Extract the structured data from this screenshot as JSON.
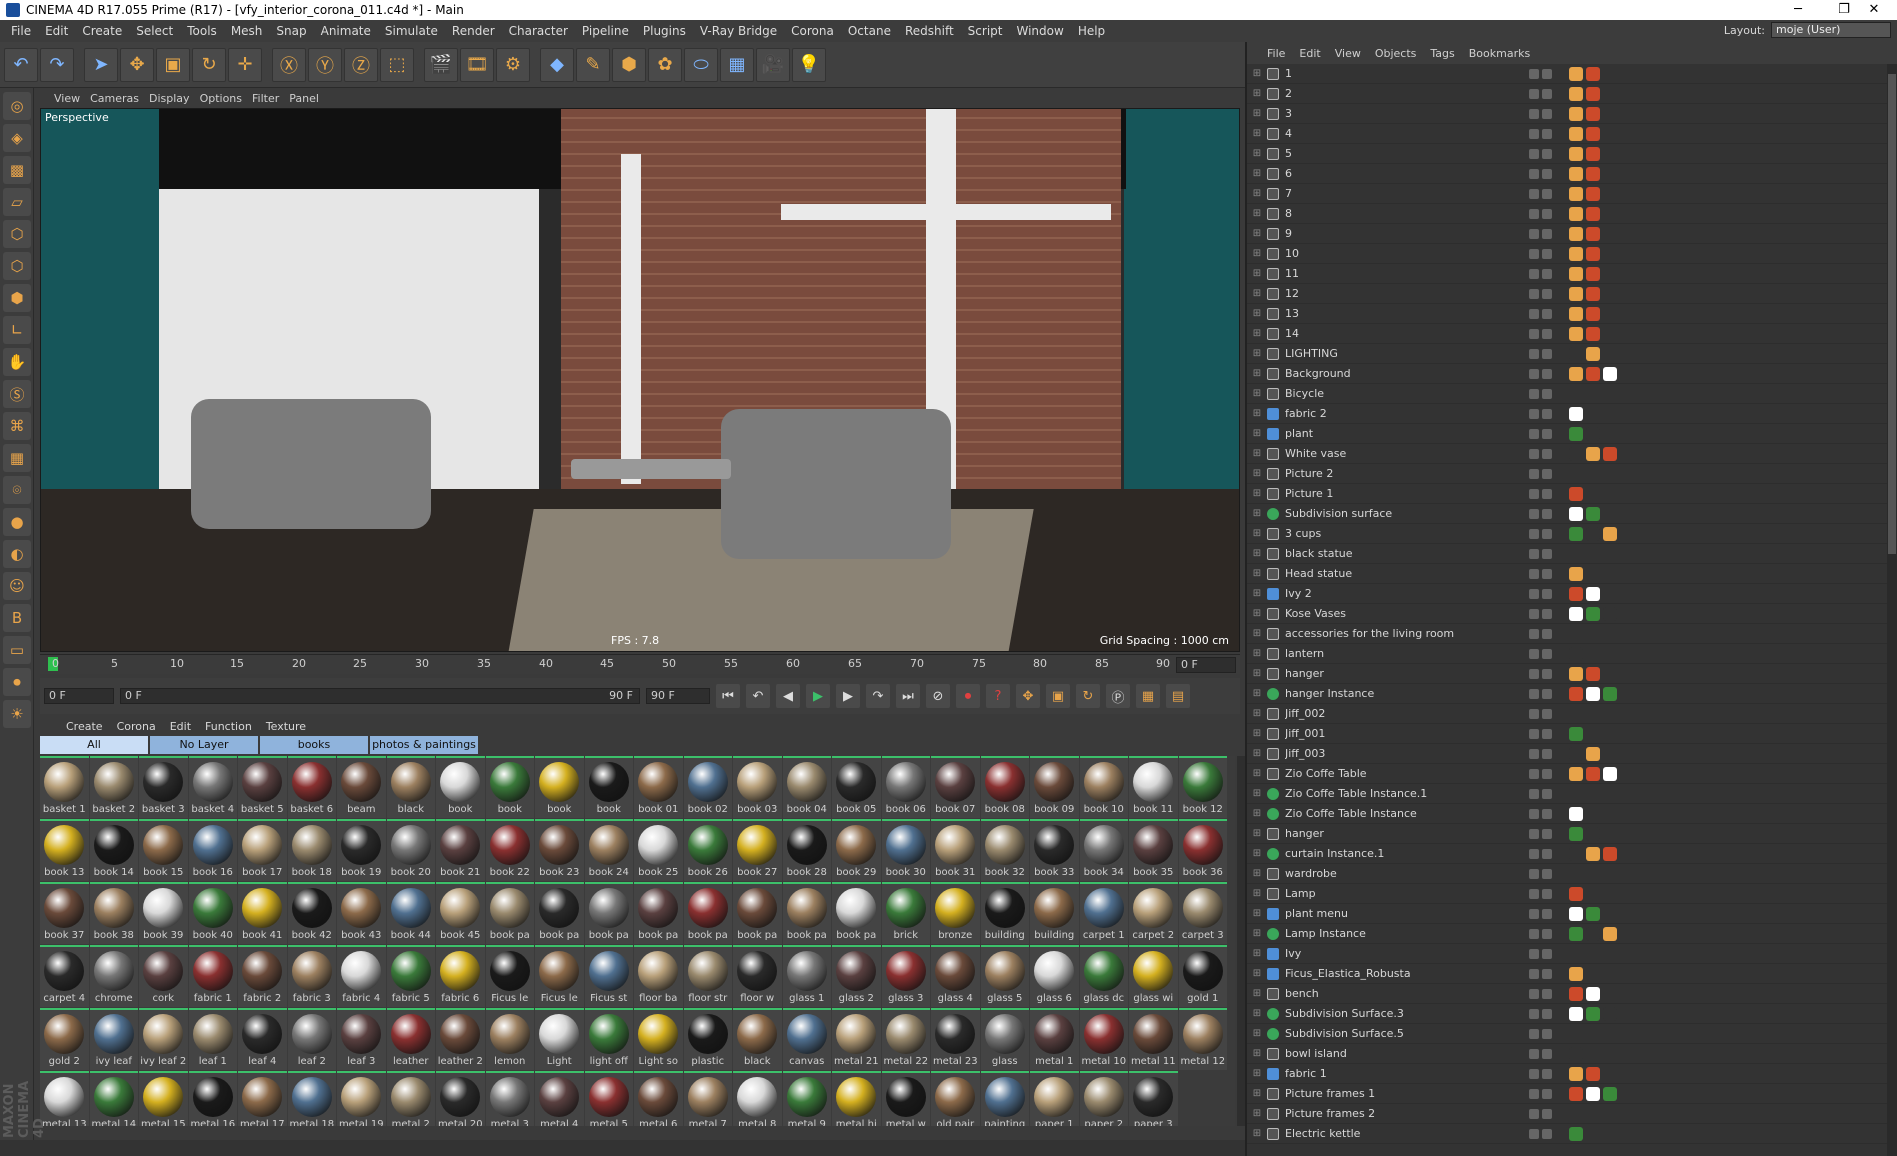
{
  "title": "CINEMA 4D R17.055 Prime (R17) - [vfy_interior_corona_011.c4d *] - Main",
  "menus": [
    "File",
    "Edit",
    "Create",
    "Select",
    "Tools",
    "Mesh",
    "Snap",
    "Animate",
    "Simulate",
    "Render",
    "Character",
    "Pipeline",
    "Plugins",
    "V-Ray Bridge",
    "Corona",
    "Octane",
    "Redshift",
    "Script",
    "Window",
    "Help"
  ],
  "layout_label": "Layout:",
  "layout_value": "moje (User)",
  "viewport": {
    "menu": [
      "View",
      "Cameras",
      "Display",
      "Options",
      "Filter",
      "Panel"
    ],
    "camera": "Perspective",
    "fps": "FPS : 7.8",
    "grid_spacing": "Grid Spacing : 1000 cm"
  },
  "timeline": {
    "ticks": [
      "0",
      "5",
      "10",
      "15",
      "20",
      "25",
      "30",
      "35",
      "40",
      "45",
      "50",
      "55",
      "60",
      "65",
      "70",
      "75",
      "80",
      "85",
      "90"
    ],
    "current_frame": "0 F"
  },
  "transport": {
    "start": "0 F",
    "range_start": "0 F",
    "range_end": "90 F",
    "end": "90 F"
  },
  "material_menu": [
    "Create",
    "Corona",
    "Edit",
    "Function",
    "Texture"
  ],
  "material_tabs": [
    "All",
    "No Layer",
    "books",
    "photos & paintings"
  ],
  "materials": [
    "basket 1",
    "basket 2",
    "basket 3",
    "basket 4",
    "basket 5",
    "basket 6",
    "beam",
    "black",
    "book",
    "book",
    "book",
    "book",
    "book 01",
    "book 02",
    "book 03",
    "book 04",
    "book 05",
    "book 06",
    "book 07",
    "book 08",
    "book 09",
    "book 10",
    "book 11",
    "book 12",
    "book 13",
    "book 14",
    "book 15",
    "book 16",
    "book 17",
    "book 18",
    "book 19",
    "book 20",
    "book 21",
    "book 22",
    "book 23",
    "book 24",
    "book 25",
    "book 26",
    "book 27",
    "book 28",
    "book 29",
    "book 30",
    "book 31",
    "book 32",
    "book 33",
    "book 34",
    "book 35",
    "book 36",
    "book 37",
    "book 38",
    "book 39",
    "book 40",
    "book 41",
    "book 42",
    "book 43",
    "book 44",
    "book 45",
    "book pa",
    "book pa",
    "book pa",
    "book pa",
    "book pa",
    "book pa",
    "book pa",
    "book pa",
    "brick",
    "bronze",
    "building",
    "building",
    "carpet 1",
    "carpet 2",
    "carpet 3",
    "carpet 4",
    "chrome",
    "cork",
    "fabric 1",
    "fabric 2",
    "fabric 3",
    "fabric 4",
    "fabric 5",
    "fabric 6",
    "Ficus le",
    "Ficus le",
    "Ficus st",
    "floor ba",
    "floor str",
    "floor w",
    "glass 1",
    "glass 2",
    "glass 3",
    "glass 4",
    "glass 5",
    "glass 6",
    "glass dc",
    "glass wi",
    "gold 1",
    "gold 2",
    "ivy leaf",
    "ivy leaf 2",
    "leaf 1",
    "leaf 4",
    "leaf 2",
    "leaf 3",
    "leather",
    "leather 2",
    "lemon",
    "Light",
    "light off",
    "Light so",
    "plastic",
    "black",
    "canvas",
    "metal 21",
    "metal 22",
    "metal 23",
    "glass",
    "metal 1",
    "metal 10",
    "metal 11",
    "metal 12",
    "metal 13",
    "metal 14",
    "metal 15",
    "metal 16",
    "metal 17",
    "metal 18",
    "metal 19",
    "metal 2",
    "metal 20",
    "metal 3",
    "metal 4",
    "metal 5",
    "metal 6",
    "metal 7",
    "metal 8",
    "metal 9",
    "metal hi",
    "metal w",
    "old pair",
    "painting",
    "paper 1",
    "paper 2",
    "paper 3"
  ],
  "object_manager": {
    "menu": [
      "File",
      "Edit",
      "View",
      "Objects",
      "Tags",
      "Bookmarks"
    ],
    "objects": [
      "1",
      "2",
      "3",
      "4",
      "5",
      "6",
      "7",
      "8",
      "9",
      "10",
      "11",
      "12",
      "13",
      "14",
      "LIGHTING",
      "Background",
      "Bicycle",
      "fabric 2",
      "plant",
      "White vase",
      "Picture 2",
      "Picture 1",
      "Subdivision surface",
      "3 cups",
      "black statue",
      "Head statue",
      "Ivy 2",
      "Kose Vases",
      "accessories for the living room",
      "lantern",
      "hanger",
      "hanger Instance",
      "Jiff_002",
      "Jiff_001",
      "Jiff_003",
      "Zio Coffe Table",
      "Zio Coffe Table Instance.1",
      "Zio Coffe Table Instance",
      "hanger",
      "curtain Instance.1",
      "wardrobe",
      "Lamp",
      "plant menu",
      "Lamp Instance",
      "Ivy",
      "Ficus_Elastica_Robusta",
      "bench",
      "Subdivision Surface.3",
      "Subdivision Surface.5",
      "bowl island",
      "fabric 1",
      "Picture frames 1",
      "Picture frames 2",
      "Electric kettle"
    ]
  },
  "brand_text": "MAXON CINEMA 4D",
  "colors": {
    "accent": "#3cc06a",
    "tab": "#8fb3dc",
    "teal": "#16565a"
  }
}
